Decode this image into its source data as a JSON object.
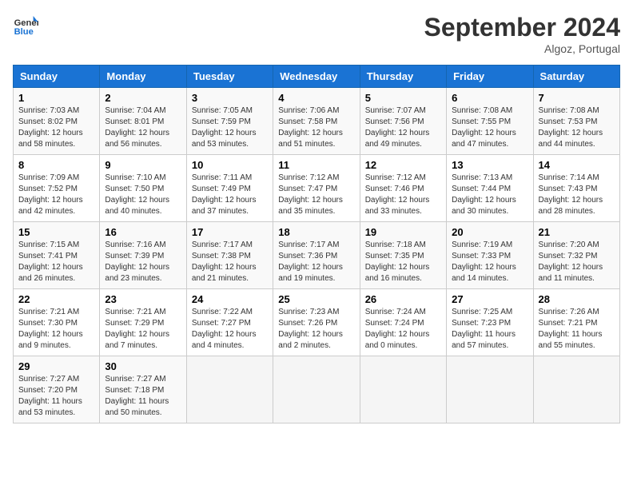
{
  "header": {
    "logo_line1": "General",
    "logo_line2": "Blue",
    "month_title": "September 2024",
    "location": "Algoz, Portugal"
  },
  "weekdays": [
    "Sunday",
    "Monday",
    "Tuesday",
    "Wednesday",
    "Thursday",
    "Friday",
    "Saturday"
  ],
  "weeks": [
    [
      {
        "day": "1",
        "sunrise": "7:03 AM",
        "sunset": "8:02 PM",
        "daylight": "12 hours and 58 minutes."
      },
      {
        "day": "2",
        "sunrise": "7:04 AM",
        "sunset": "8:01 PM",
        "daylight": "12 hours and 56 minutes."
      },
      {
        "day": "3",
        "sunrise": "7:05 AM",
        "sunset": "7:59 PM",
        "daylight": "12 hours and 53 minutes."
      },
      {
        "day": "4",
        "sunrise": "7:06 AM",
        "sunset": "7:58 PM",
        "daylight": "12 hours and 51 minutes."
      },
      {
        "day": "5",
        "sunrise": "7:07 AM",
        "sunset": "7:56 PM",
        "daylight": "12 hours and 49 minutes."
      },
      {
        "day": "6",
        "sunrise": "7:08 AM",
        "sunset": "7:55 PM",
        "daylight": "12 hours and 47 minutes."
      },
      {
        "day": "7",
        "sunrise": "7:08 AM",
        "sunset": "7:53 PM",
        "daylight": "12 hours and 44 minutes."
      }
    ],
    [
      {
        "day": "8",
        "sunrise": "7:09 AM",
        "sunset": "7:52 PM",
        "daylight": "12 hours and 42 minutes."
      },
      {
        "day": "9",
        "sunrise": "7:10 AM",
        "sunset": "7:50 PM",
        "daylight": "12 hours and 40 minutes."
      },
      {
        "day": "10",
        "sunrise": "7:11 AM",
        "sunset": "7:49 PM",
        "daylight": "12 hours and 37 minutes."
      },
      {
        "day": "11",
        "sunrise": "7:12 AM",
        "sunset": "7:47 PM",
        "daylight": "12 hours and 35 minutes."
      },
      {
        "day": "12",
        "sunrise": "7:12 AM",
        "sunset": "7:46 PM",
        "daylight": "12 hours and 33 minutes."
      },
      {
        "day": "13",
        "sunrise": "7:13 AM",
        "sunset": "7:44 PM",
        "daylight": "12 hours and 30 minutes."
      },
      {
        "day": "14",
        "sunrise": "7:14 AM",
        "sunset": "7:43 PM",
        "daylight": "12 hours and 28 minutes."
      }
    ],
    [
      {
        "day": "15",
        "sunrise": "7:15 AM",
        "sunset": "7:41 PM",
        "daylight": "12 hours and 26 minutes."
      },
      {
        "day": "16",
        "sunrise": "7:16 AM",
        "sunset": "7:39 PM",
        "daylight": "12 hours and 23 minutes."
      },
      {
        "day": "17",
        "sunrise": "7:17 AM",
        "sunset": "7:38 PM",
        "daylight": "12 hours and 21 minutes."
      },
      {
        "day": "18",
        "sunrise": "7:17 AM",
        "sunset": "7:36 PM",
        "daylight": "12 hours and 19 minutes."
      },
      {
        "day": "19",
        "sunrise": "7:18 AM",
        "sunset": "7:35 PM",
        "daylight": "12 hours and 16 minutes."
      },
      {
        "day": "20",
        "sunrise": "7:19 AM",
        "sunset": "7:33 PM",
        "daylight": "12 hours and 14 minutes."
      },
      {
        "day": "21",
        "sunrise": "7:20 AM",
        "sunset": "7:32 PM",
        "daylight": "12 hours and 11 minutes."
      }
    ],
    [
      {
        "day": "22",
        "sunrise": "7:21 AM",
        "sunset": "7:30 PM",
        "daylight": "12 hours and 9 minutes."
      },
      {
        "day": "23",
        "sunrise": "7:21 AM",
        "sunset": "7:29 PM",
        "daylight": "12 hours and 7 minutes."
      },
      {
        "day": "24",
        "sunrise": "7:22 AM",
        "sunset": "7:27 PM",
        "daylight": "12 hours and 4 minutes."
      },
      {
        "day": "25",
        "sunrise": "7:23 AM",
        "sunset": "7:26 PM",
        "daylight": "12 hours and 2 minutes."
      },
      {
        "day": "26",
        "sunrise": "7:24 AM",
        "sunset": "7:24 PM",
        "daylight": "12 hours and 0 minutes."
      },
      {
        "day": "27",
        "sunrise": "7:25 AM",
        "sunset": "7:23 PM",
        "daylight": "11 hours and 57 minutes."
      },
      {
        "day": "28",
        "sunrise": "7:26 AM",
        "sunset": "7:21 PM",
        "daylight": "11 hours and 55 minutes."
      }
    ],
    [
      {
        "day": "29",
        "sunrise": "7:27 AM",
        "sunset": "7:20 PM",
        "daylight": "11 hours and 53 minutes."
      },
      {
        "day": "30",
        "sunrise": "7:27 AM",
        "sunset": "7:18 PM",
        "daylight": "11 hours and 50 minutes."
      },
      null,
      null,
      null,
      null,
      null
    ]
  ]
}
